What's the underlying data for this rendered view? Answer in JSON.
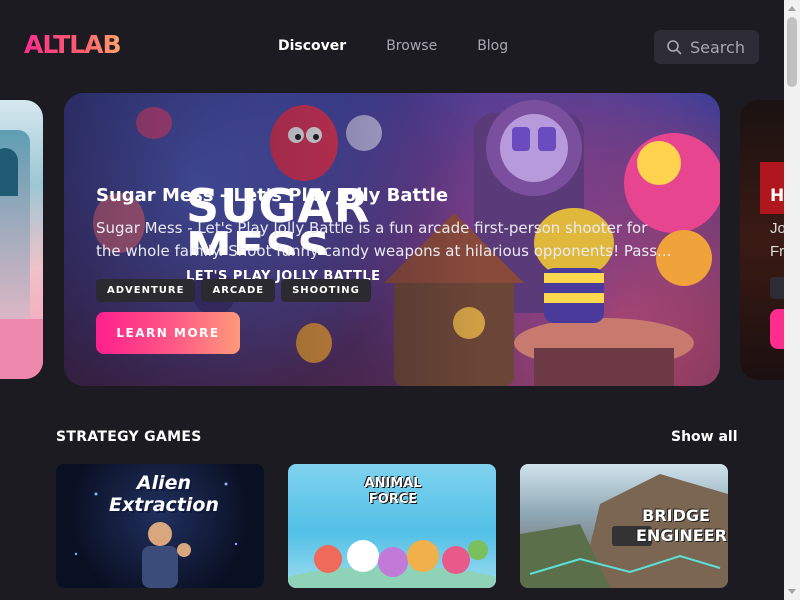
{
  "header": {
    "logo": "ALTLAB",
    "nav": [
      {
        "label": "Discover",
        "active": true
      },
      {
        "label": "Browse",
        "active": false
      },
      {
        "label": "Blog",
        "active": false
      }
    ],
    "search_label": "Search",
    "search_icon": "search-icon"
  },
  "hero": {
    "title": "Sugar Mess - Let's Play Jolly Battle",
    "description": "Sugar Mess - Let's Play Jolly Battle is a fun arcade first-person shooter for the whole family. Shoot funny candy weapons at hilarious opponents! Pass...",
    "tags": [
      "ADVENTURE",
      "ARCADE",
      "SHOOTING"
    ],
    "cta": "LEARN MORE",
    "art_logo_line1": "SUGAR",
    "art_logo_line2": "MESS",
    "art_logo_sub": "LET'S PLAY JOLLY BATTLE"
  },
  "next_card": {
    "title_initial": "H",
    "line1": "Jo",
    "line2": "Fr"
  },
  "strategy": {
    "title": "STRATEGY GAMES",
    "show_all": "Show all",
    "games": [
      {
        "title": "Alien Extraction"
      },
      {
        "title": "ANIMAL FORCE"
      },
      {
        "title": "BRIDGE ENGINEER"
      }
    ]
  },
  "colors": {
    "background": "#1c1b21",
    "accent_gradient_start": "#ff1f8e",
    "accent_gradient_end": "#ff9a7a",
    "tag_bg": "#2b2a31"
  }
}
